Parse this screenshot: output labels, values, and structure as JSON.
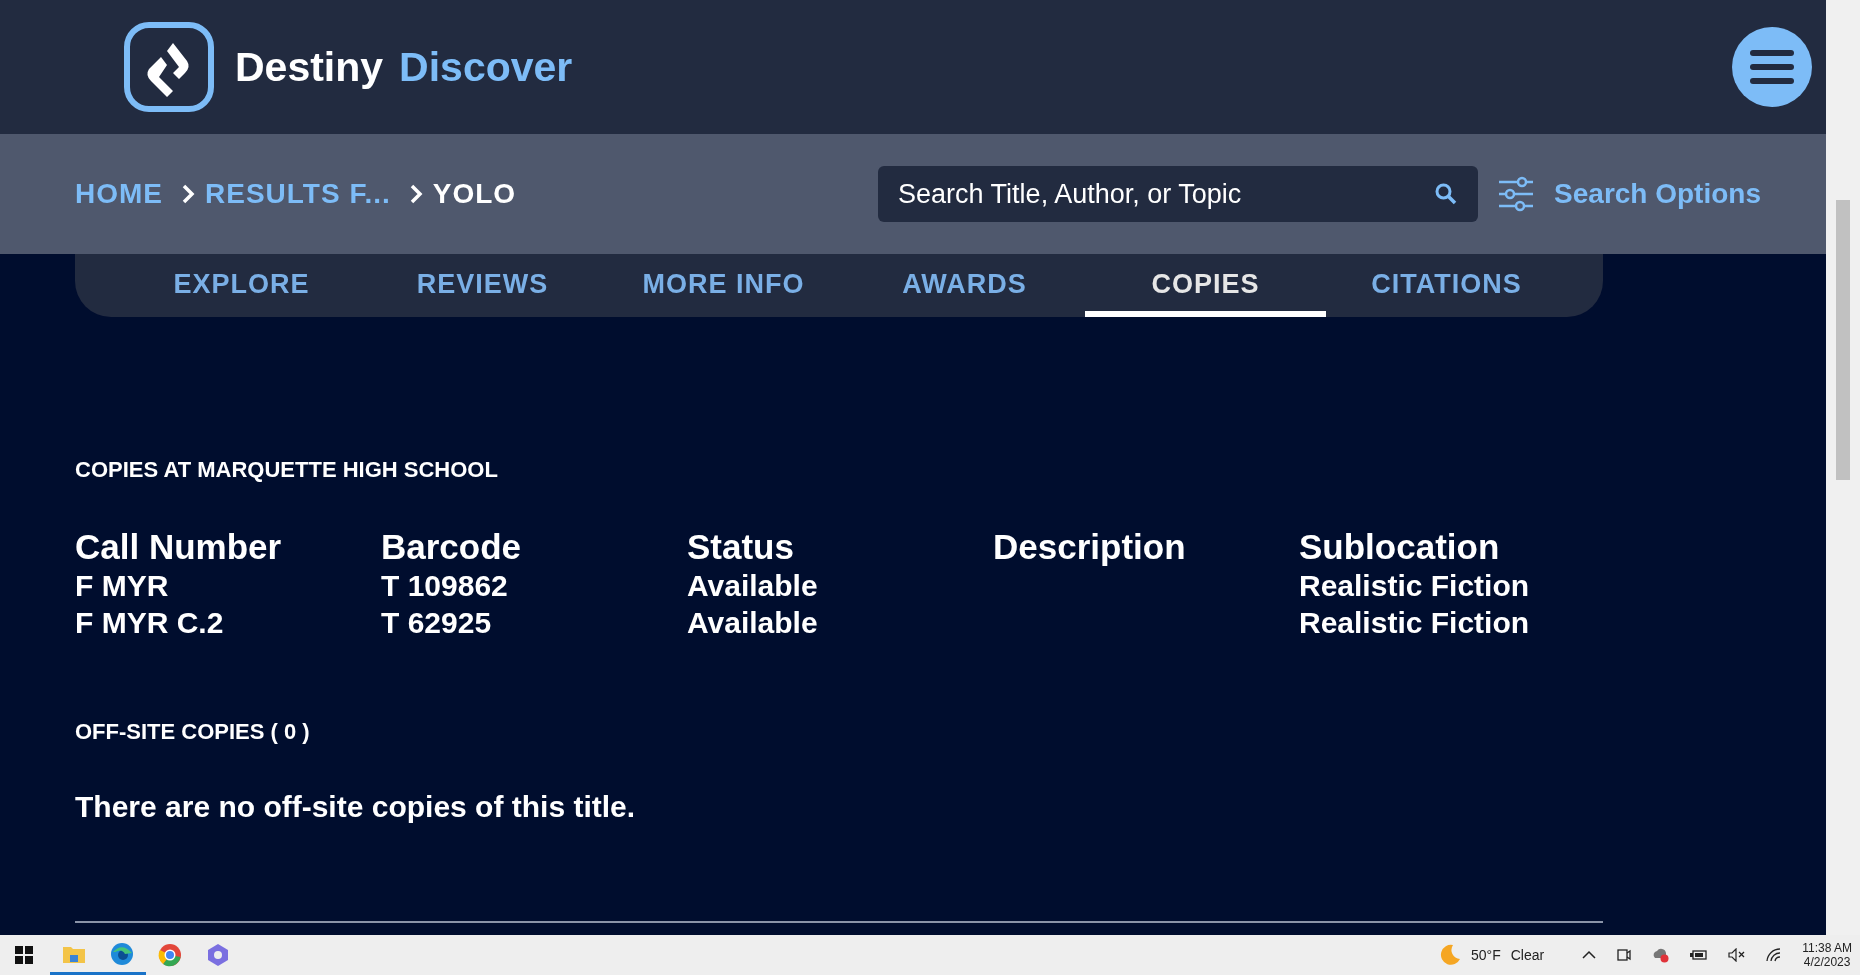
{
  "header": {
    "brand": "Destiny",
    "product": "Discover"
  },
  "breadcrumb": [
    {
      "label": "HOME",
      "current": false
    },
    {
      "label": "RESULTS F...",
      "current": false
    },
    {
      "label": "YOLO",
      "current": true
    }
  ],
  "search": {
    "placeholder": "Search Title, Author, or Topic"
  },
  "search_options": "Search Options",
  "tabs": [
    {
      "label": "EXPLORE",
      "selected": false
    },
    {
      "label": "REVIEWS",
      "selected": false
    },
    {
      "label": "MORE INFO",
      "selected": false
    },
    {
      "label": "AWARDS",
      "selected": false
    },
    {
      "label": "COPIES",
      "selected": true
    },
    {
      "label": "CITATIONS",
      "selected": false
    }
  ],
  "copies_section": {
    "title": "COPIES AT MARQUETTE HIGH SCHOOL",
    "columns": [
      "Call Number",
      "Barcode",
      "Status",
      "Description",
      "Sublocation"
    ],
    "rows": [
      [
        "F MYR",
        "T 109862",
        "Available",
        "",
        "Realistic Fiction"
      ],
      [
        "F MYR C.2",
        "T 62925",
        "Available",
        "",
        "Realistic Fiction"
      ]
    ]
  },
  "offsite_section": {
    "title": "OFF-SITE COPIES ( 0 )",
    "message": "There are no off-site copies of this title."
  },
  "taskbar": {
    "weather": "50°F",
    "condition": "Clear",
    "time": "11:38 AM",
    "date": "4/2/2023"
  }
}
